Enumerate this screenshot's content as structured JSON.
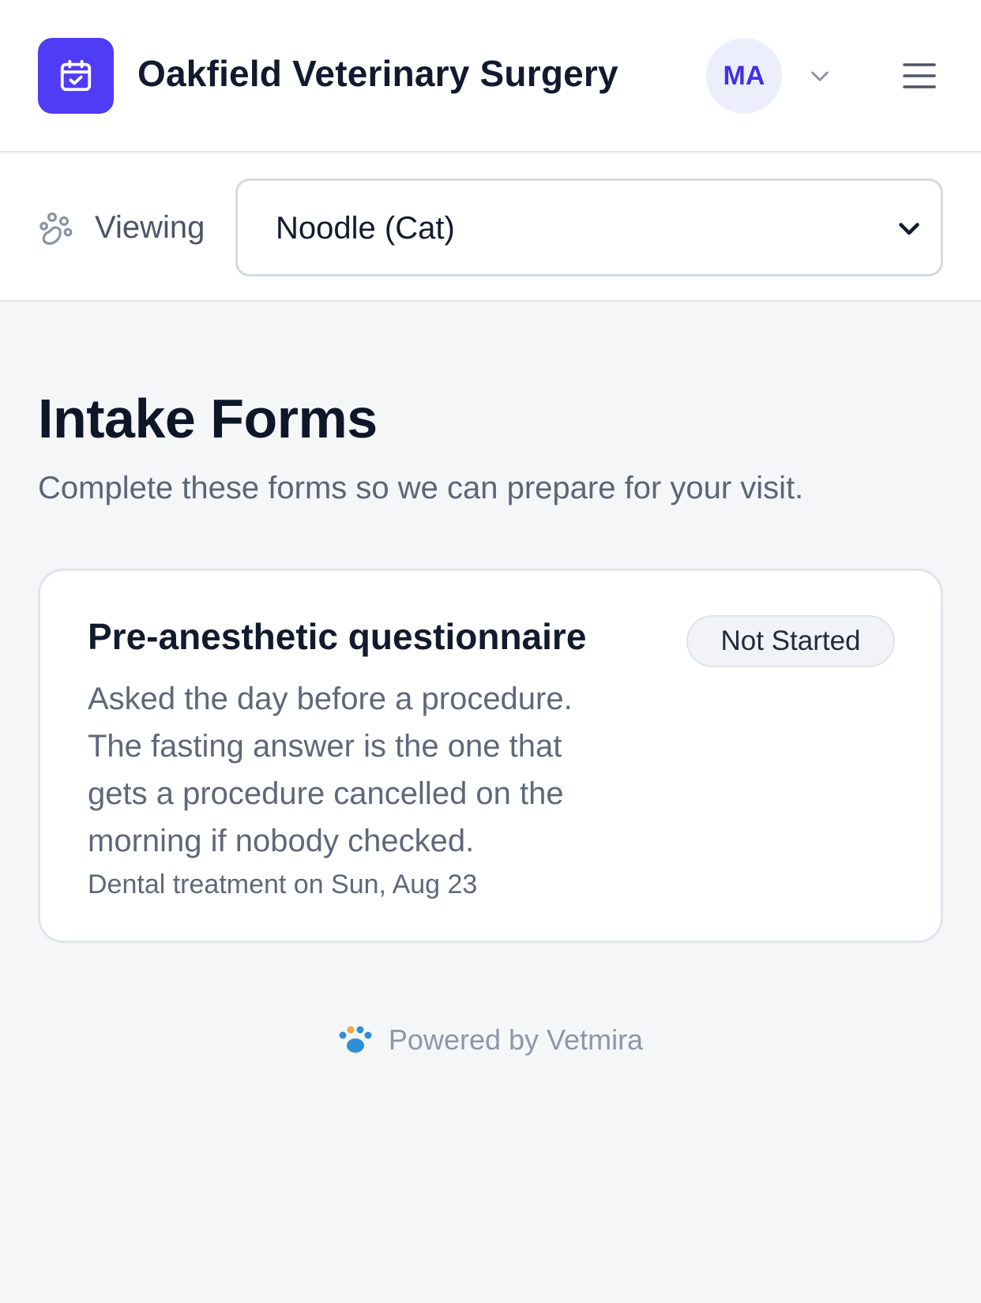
{
  "header": {
    "clinic_name": "Oakfield Veterinary Surgery",
    "avatar_initials": "MA",
    "logo_icon": "calendar-check-icon",
    "menu_icon": "hamburger-menu-icon",
    "brand_color": "#4f3cf7"
  },
  "pet_selector": {
    "label": "Viewing",
    "selected": "Noodle (Cat)"
  },
  "main": {
    "title": "Intake Forms",
    "subtitle": "Complete these forms so we can prepare for your visit."
  },
  "forms": [
    {
      "title": "Pre-anesthetic questionnaire",
      "status": "Not Started",
      "description": "Asked the day before a procedure. The fasting answer is the one that gets a procedure cancelled on the morning if nobody checked.",
      "meta": "Dental treatment on Sun, Aug 23"
    }
  ],
  "footer": {
    "text": "Powered by Vetmira"
  }
}
